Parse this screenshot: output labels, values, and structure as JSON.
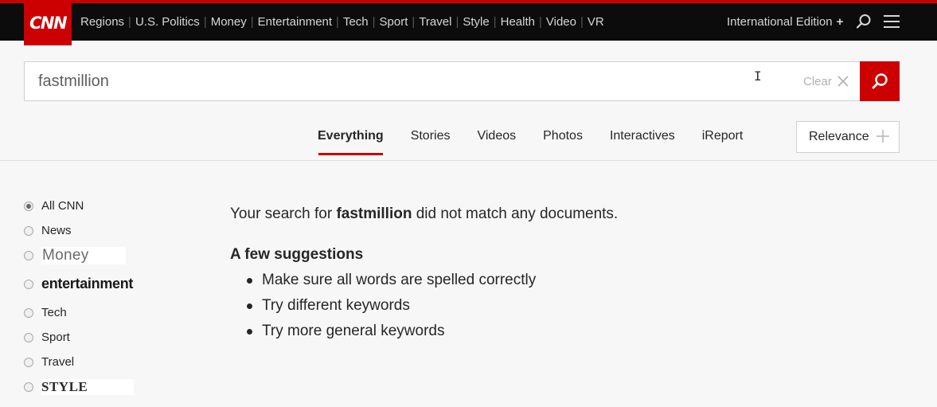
{
  "header": {
    "logo_text": "CNN",
    "nav_links": [
      "Regions",
      "U.S. Politics",
      "Money",
      "Entertainment",
      "Tech",
      "Sport",
      "Travel",
      "Style",
      "Health",
      "Video",
      "VR"
    ],
    "edition_label": "International Edition",
    "edition_plus": "+"
  },
  "search": {
    "query": "fastmillion",
    "clear_label": "Clear"
  },
  "tabs": [
    {
      "label": "Everything",
      "active": true
    },
    {
      "label": "Stories",
      "active": false
    },
    {
      "label": "Videos",
      "active": false
    },
    {
      "label": "Photos",
      "active": false
    },
    {
      "label": "Interactives",
      "active": false
    },
    {
      "label": "iReport",
      "active": false
    }
  ],
  "sort": {
    "label": "Relevance"
  },
  "filters": [
    {
      "label": "All CNN",
      "checked": true
    },
    {
      "label": "News",
      "checked": false
    },
    {
      "label": "Money",
      "checked": false
    },
    {
      "label": "entertainment",
      "checked": false
    },
    {
      "label": "Tech",
      "checked": false
    },
    {
      "label": "Sport",
      "checked": false
    },
    {
      "label": "Travel",
      "checked": false
    },
    {
      "label": "STYLE",
      "checked": false
    }
  ],
  "results": {
    "message_prefix": "Your search for",
    "message_query": "fastmillion",
    "message_suffix": "did not match any documents.",
    "suggestions_title": "A few suggestions",
    "suggestions": [
      "Make sure all words are spelled correctly",
      "Try different keywords",
      "Try more general keywords"
    ]
  },
  "colors": {
    "brand_red": "#cc0000",
    "nav_bg": "#0c0c0c"
  }
}
